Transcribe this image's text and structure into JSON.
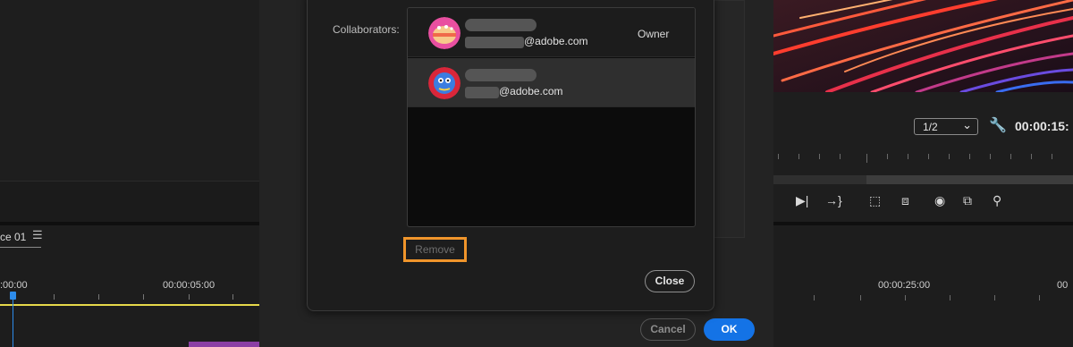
{
  "timeline_left": {
    "sequence_tab": "ce 01",
    "menu_glyph": "☰",
    "timecodes": [
      ":00:00",
      "00:00:05:00"
    ]
  },
  "program_monitor": {
    "resolution": "1/2",
    "timecode": "00:00:15:",
    "controls": [
      "step-forward-icon",
      "go-to-out-icon",
      "lift-icon",
      "extract-icon",
      "export-frame-icon",
      "compare-icon",
      "proxy-icon"
    ]
  },
  "timeline_right": {
    "timecodes": [
      "00:00:25:00",
      "00"
    ]
  },
  "share_dialog": {
    "collaborators_label": "Collaborators:",
    "collaborators": [
      {
        "email_domain": "@adobe.com",
        "role": "Owner"
      },
      {
        "email_domain": "@adobe.com",
        "role": ""
      }
    ],
    "remove_label": "Remove",
    "close_label": "Close"
  },
  "parent_dialog": {
    "cancel_label": "Cancel",
    "ok_label": "OK"
  },
  "colors": {
    "accent": "#1473e6",
    "highlight": "#f0952b",
    "playhead": "#2d8ceb",
    "work_area": "#e6d84a"
  }
}
